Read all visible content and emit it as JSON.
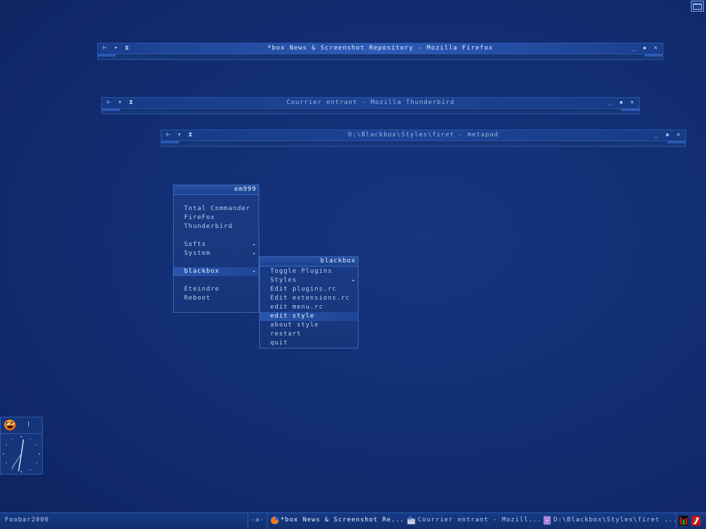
{
  "windows": [
    {
      "title": "*box News & Screenshot Repository - Mozilla Firefox",
      "active": true
    },
    {
      "title": "Courrier entrant - Mozilla Thunderbird",
      "active": false
    },
    {
      "title": "D:\\Blackbox\\Styles\\firet - metapad",
      "active": false
    }
  ],
  "window_controls": {
    "left": [
      "⊢",
      "▾",
      "⧗"
    ],
    "right": [
      "_",
      "▪",
      "×"
    ]
  },
  "root_menu": {
    "title": "em999",
    "items": [
      "Total Commander",
      "FireFox",
      "Thunderbird",
      "Softs",
      "System",
      "blackbox",
      "Eteindre",
      "Reboot"
    ]
  },
  "blackbox_menu": {
    "title": "blackbox",
    "items": [
      "Toggle Plugins",
      "Styles",
      "Edit plugins.rc",
      "Edit extensions.rc",
      "edit menu.rc",
      "edit style",
      "about style",
      "restart",
      "quit"
    ]
  },
  "submenu_arrow": "▸",
  "taskbar": {
    "label": "Foobar2000",
    "workspace": "-a-",
    "tasks": [
      {
        "label": "*box News & Screenshot Re...",
        "icon": "firefox-icon"
      },
      {
        "label": "Courrier entrant - Mozill...",
        "icon": "thunderbird-icon"
      },
      {
        "label": "D:\\Blackbox\\Styles\\firet ...",
        "icon": "metapad-icon"
      }
    ]
  },
  "colors": {
    "desktop": "#122e74",
    "accent": "#2c5bb8",
    "text": "#b9cbec"
  }
}
